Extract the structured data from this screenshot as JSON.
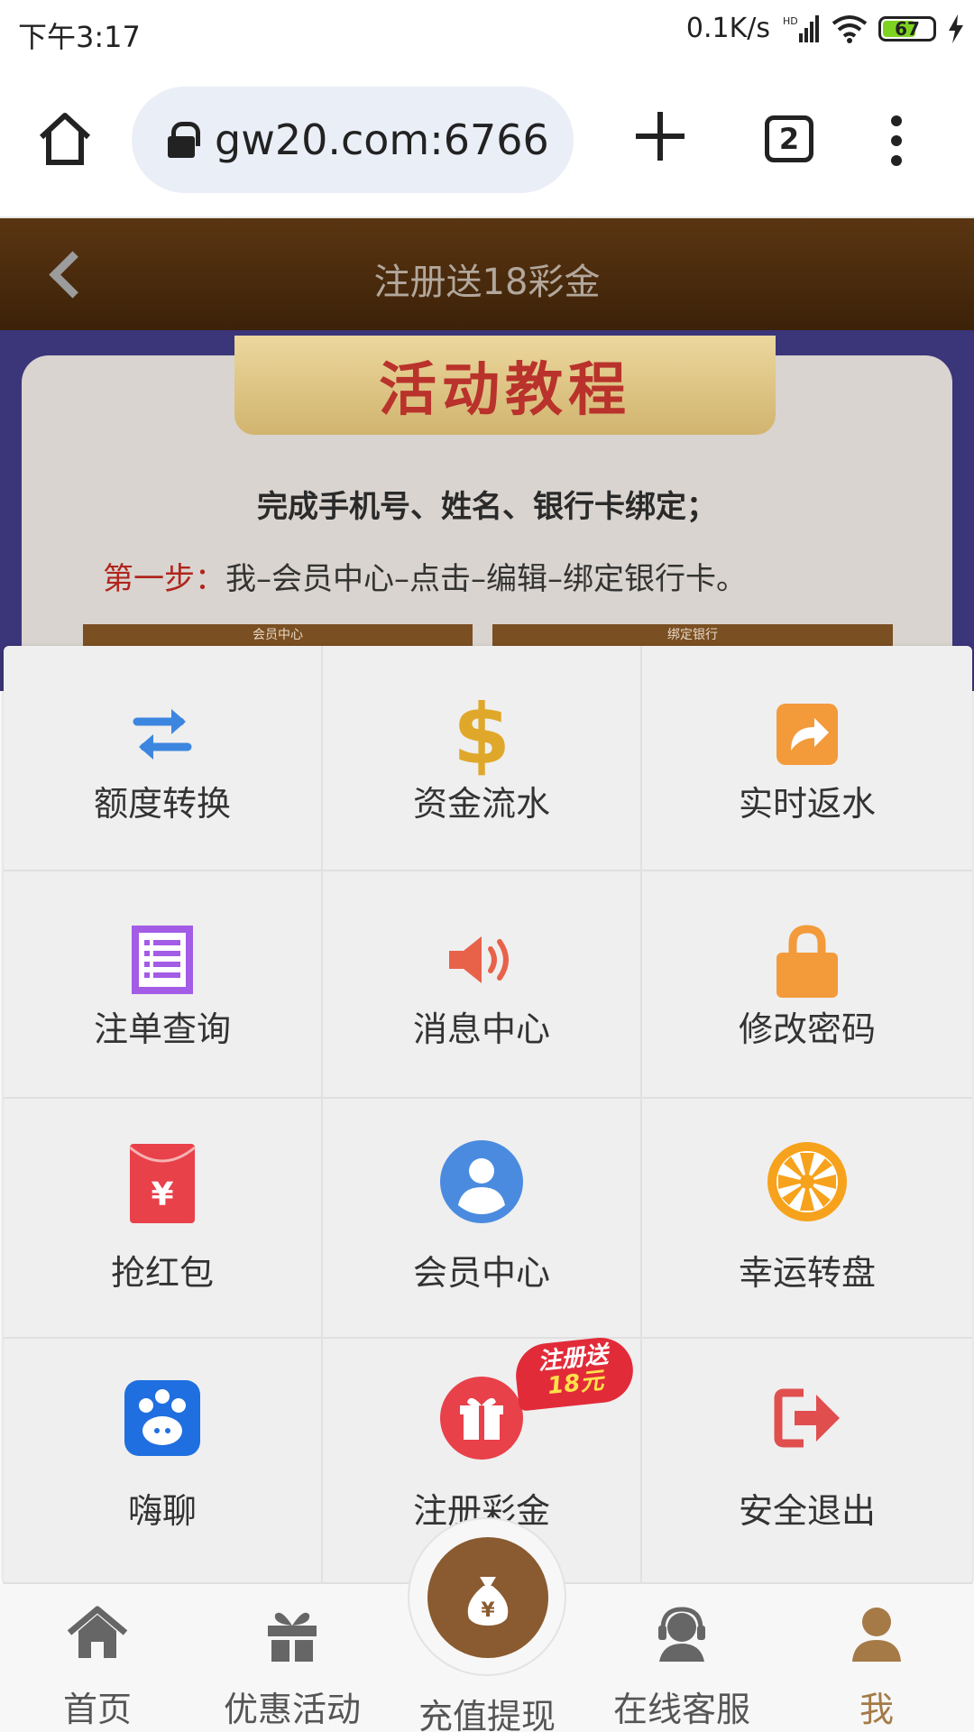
{
  "status_bar": {
    "time": "下午3:17",
    "net_speed": "0.1K/s",
    "network_tag": "HD",
    "battery": "67"
  },
  "browser": {
    "url": "gw20.com:6766",
    "tab_count": "2"
  },
  "header": {
    "title": "注册送18彩金"
  },
  "background": {
    "banner": "活动教程",
    "line1": "完成手机号、姓名、银行卡绑定；",
    "step_label": "第一步：",
    "step_text": "我–会员中心–点击–编辑–绑定银行卡。",
    "mini1": "会员中心",
    "mini2": "绑定银行"
  },
  "menu": {
    "items": [
      {
        "label": "额度转换",
        "icon": "transfer-icon",
        "color": "#3d86e0"
      },
      {
        "label": "资金流水",
        "icon": "dollar-icon",
        "color": "#e0a82a"
      },
      {
        "label": "实时返水",
        "icon": "share-arrow-icon",
        "color": "#f39a3b"
      },
      {
        "label": "注单查询",
        "icon": "list-icon",
        "color": "#a35ce6"
      },
      {
        "label": "消息中心",
        "icon": "speaker-icon",
        "color": "#e8624a"
      },
      {
        "label": "修改密码",
        "icon": "lock-icon",
        "color": "#f39a3b"
      },
      {
        "label": "抢红包",
        "icon": "red-envelope-icon",
        "color": "#e8414a"
      },
      {
        "label": "会员中心",
        "icon": "user-icon",
        "color": "#4a8be0"
      },
      {
        "label": "幸运转盘",
        "icon": "wheel-icon",
        "color": "#f7a21c"
      },
      {
        "label": "嗨聊",
        "icon": "chat-paw-icon",
        "color": "#1f6fe0"
      },
      {
        "label": "注册彩金",
        "icon": "gift-icon",
        "color": "#e8414a"
      },
      {
        "label": "安全退出",
        "icon": "logout-icon",
        "color": "#e14e4e"
      }
    ],
    "badge_line1": "注册送",
    "badge_line2": "18元"
  },
  "nav": {
    "home": "首页",
    "promos": "优惠活动",
    "deposit": "充值提现",
    "support": "在线客服",
    "me": "我",
    "active_color": "#a57a47"
  }
}
